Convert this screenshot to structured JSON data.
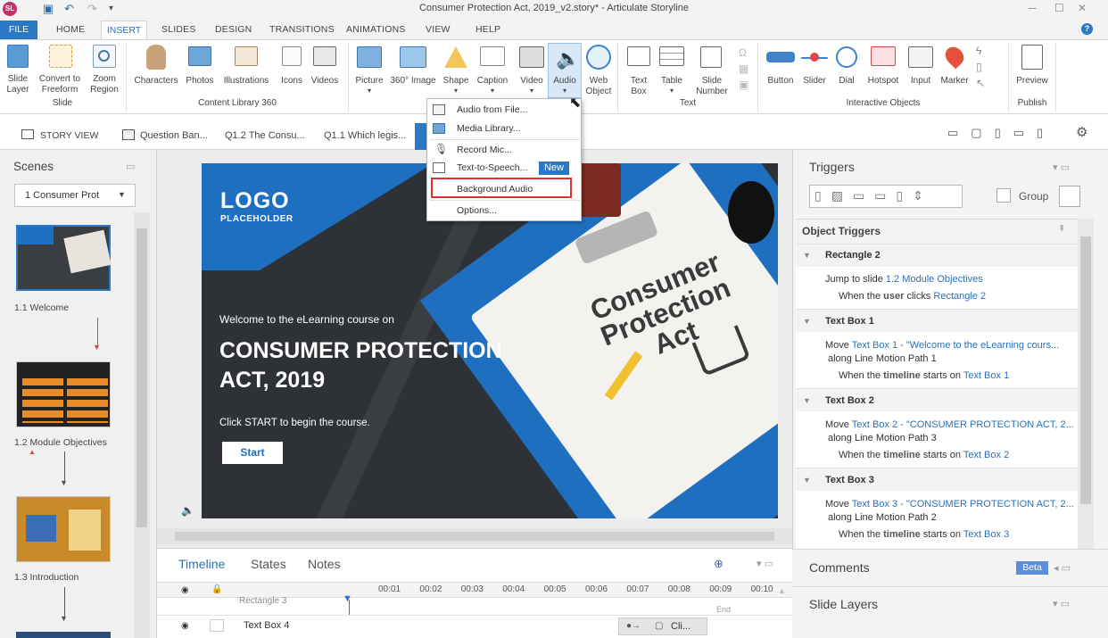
{
  "app": {
    "title": "Consumer Protection Act, 2019_v2.story* - Articulate Storyline",
    "icon_text": "SL"
  },
  "tabs": [
    "FILE",
    "HOME",
    "INSERT",
    "SLIDES",
    "DESIGN",
    "TRANSITIONS",
    "ANIMATIONS",
    "VIEW",
    "HELP"
  ],
  "ribbon": {
    "slide": {
      "items": [
        [
          "Slide",
          "Layer"
        ],
        [
          "Convert to",
          "Freeform"
        ],
        [
          "Zoom",
          "Region"
        ]
      ],
      "label": "Slide"
    },
    "library": {
      "items": [
        "Characters",
        "Photos",
        "Illustrations",
        "Icons",
        "Videos"
      ],
      "label": "Content Library 360"
    },
    "media": {
      "items": [
        "Picture",
        "360° Image",
        "Shape",
        "Caption",
        "Video",
        "Audio"
      ],
      "web": [
        "Web",
        "Object"
      ]
    },
    "text": {
      "items": [
        [
          "Text",
          "Box"
        ],
        [
          "Table",
          ""
        ],
        [
          "Slide",
          "Number"
        ]
      ],
      "label": "Text"
    },
    "interactive": {
      "items": [
        "Button",
        "Slider",
        "Dial",
        "Hotspot",
        "Input",
        "Marker"
      ],
      "label": "Interactive Objects"
    },
    "publish": {
      "item": "Preview",
      "label": "Publish"
    }
  },
  "storybar": {
    "story_view": "STORY VIEW",
    "tabs": [
      "Question Ban...",
      "Q1.2 The Consu...",
      "Q1.1 Which legis..."
    ]
  },
  "scenes": {
    "title": "Scenes",
    "selected": "1 Consumer Prot",
    "slides": [
      "1.1 Welcome",
      "1.2 Module Objectives",
      "1.3 Introduction"
    ]
  },
  "slide": {
    "logo": "LOGO",
    "logo_sub": "PLACEHOLDER",
    "welcome": "Welcome to the eLearning course on",
    "title_line1": "CONSUMER PROTECTION",
    "title_line2": "ACT, 2019",
    "click": "Click START to begin the course.",
    "start": "Start",
    "clip_l1": "Consumer",
    "clip_l2": "Protection",
    "clip_l3": "Act"
  },
  "audio_menu": {
    "items": [
      "Audio from File...",
      "Media Library...",
      "Record Mic...",
      "Text-to-Speech...",
      "Background Audio",
      "Options..."
    ],
    "new_badge": "New"
  },
  "timeline": {
    "tabs": [
      "Timeline",
      "States",
      "Notes"
    ],
    "ticks": [
      "00:01",
      "00:02",
      "00:03",
      "00:04",
      "00:05",
      "00:06",
      "00:07",
      "00:08",
      "00:09",
      "00:10"
    ],
    "rows": [
      "Rectangle 3",
      "Text Box 4"
    ],
    "end": "End",
    "clip": "Cli..."
  },
  "triggers": {
    "title": "Triggers",
    "group": "Group",
    "object_triggers": "Object Triggers",
    "sections": [
      {
        "name": "Rectangle 2",
        "line1a": "Jump to slide ",
        "line1b": "1.2 Module Objectives",
        "line2a": "When the ",
        "line2b": "user",
        "line2c": " clicks ",
        "line2d": "Rectangle 2"
      },
      {
        "name": "Text Box 1",
        "line1a": "Move ",
        "line1b": "Text Box 1 - \"Welcome to the eLearning cours...",
        "line1c": "along Line Motion Path 1",
        "line2a": "When the ",
        "line2b": "timeline",
        "line2c": " starts on ",
        "line2d": "Text Box 1"
      },
      {
        "name": "Text Box 2",
        "line1a": "Move ",
        "line1b": "Text Box 2 - \"CONSUMER PROTECTION ACT, 2...",
        "line1c": "along Line Motion Path 3",
        "line2a": "When the ",
        "line2b": "timeline",
        "line2c": " starts on ",
        "line2d": "Text Box 2"
      },
      {
        "name": "Text Box 3",
        "line1a": "Move ",
        "line1b": "Text Box 3 - \"CONSUMER PROTECTION ACT, 2...",
        "line1c": "along Line Motion Path 2",
        "line2a": "When the ",
        "line2b": "timeline",
        "line2c": " starts on ",
        "line2d": "Text Box 3"
      }
    ],
    "comments": "Comments",
    "beta": "Beta",
    "slide_layers": "Slide Layers"
  }
}
